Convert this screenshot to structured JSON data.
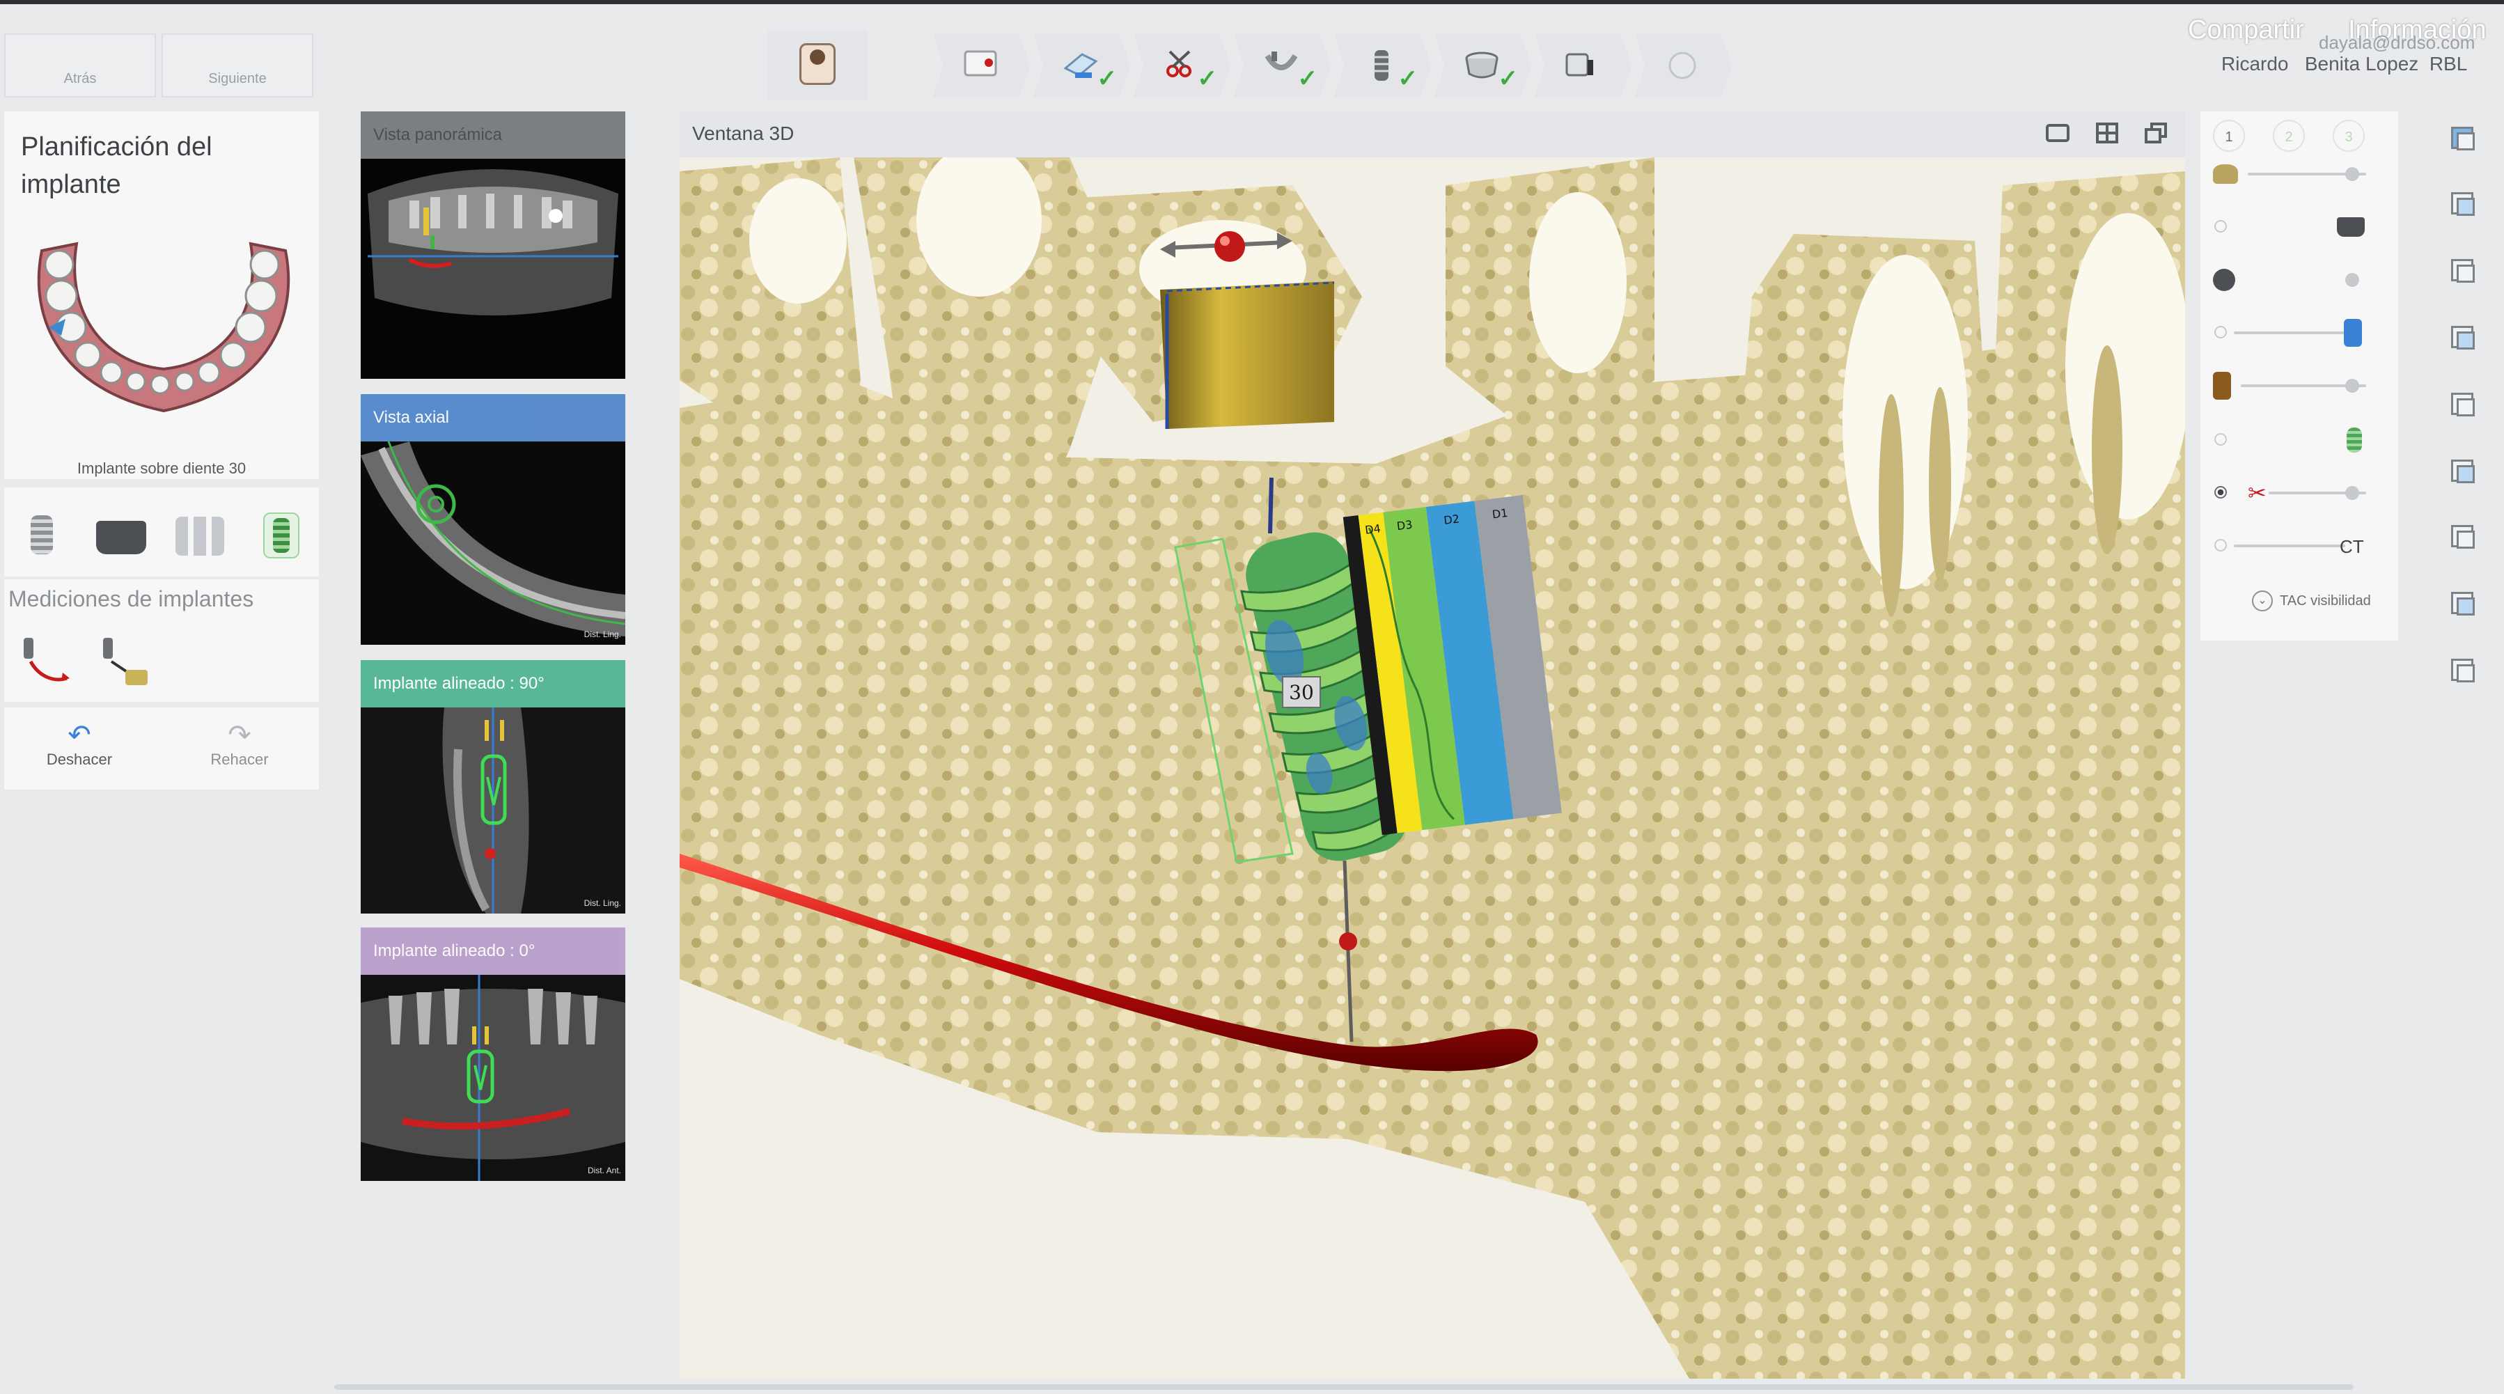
{
  "nav": {
    "back_label": "Atrás",
    "next_label": "Siguiente"
  },
  "header": {
    "share_label": "Compartir",
    "info_label": "Información",
    "email": "dayala@drdso.com",
    "user_name": "Ricardo   Benita Lopez  RBL"
  },
  "workflow_steps": [
    {
      "icon": "patient-icon",
      "done": false
    },
    {
      "icon": "prescription-icon",
      "done": false
    },
    {
      "icon": "scan-icon",
      "done": true
    },
    {
      "icon": "segmentation-icon",
      "done": true
    },
    {
      "icon": "jaw-icon",
      "done": true
    },
    {
      "icon": "implant-icon",
      "done": true
    },
    {
      "icon": "sleeve-icon",
      "done": true
    },
    {
      "icon": "guide-icon",
      "done": false
    },
    {
      "icon": "export-icon",
      "done": false
    }
  ],
  "left_panel": {
    "title": "Planificación del implante",
    "caption": "Implante sobre diente 30",
    "implant_tools": [
      "implant-icon",
      "abutment-icon",
      "multi-implant-icon",
      "selected-implant-icon"
    ],
    "measurements_title": "Mediciones de implantes",
    "measure_tools": [
      "distance-measure-icon",
      "angle-measure-icon"
    ],
    "undo_label": "Deshacer",
    "redo_label": "Rehacer"
  },
  "views": [
    {
      "title": "Vista panorámica",
      "header_color": "#7b7e82"
    },
    {
      "title": "Vista axial",
      "header_color": "#4a82c9"
    },
    {
      "title": "Implante alineado : 90°",
      "header_color": "#58b896"
    },
    {
      "title": "Implante alineado : 0°",
      "header_color": "#b195c7"
    }
  ],
  "view_tags": {
    "axial": "Dist. Ling.",
    "aligned90": "Dist. Ling.",
    "aligned0": "Dist. Ant."
  },
  "window_3d": {
    "title": "Ventana 3D",
    "implant_number": "30",
    "density_labels": [
      "D4",
      "D3",
      "D2",
      "D1"
    ],
    "toolbar_icons": [
      "screenshot-icon",
      "layout-grid-icon",
      "maximize-icon"
    ]
  },
  "right_panel": {
    "tabs": [
      "1",
      "2",
      "3"
    ],
    "ct_label": "CT",
    "tac_label": "TAC visibilidad",
    "side_icons": [
      "view-front-icon",
      "view-back-icon",
      "view-left-icon",
      "view-right-icon",
      "view-top-icon",
      "view-bottom-icon",
      "view-iso-icon",
      "camera-icon",
      "reset-view-icon"
    ]
  },
  "colors": {
    "accent": "#3caa3c",
    "bone": "#d8cc98",
    "nerve": "#c80a0a",
    "implant": "#4fa85a"
  }
}
